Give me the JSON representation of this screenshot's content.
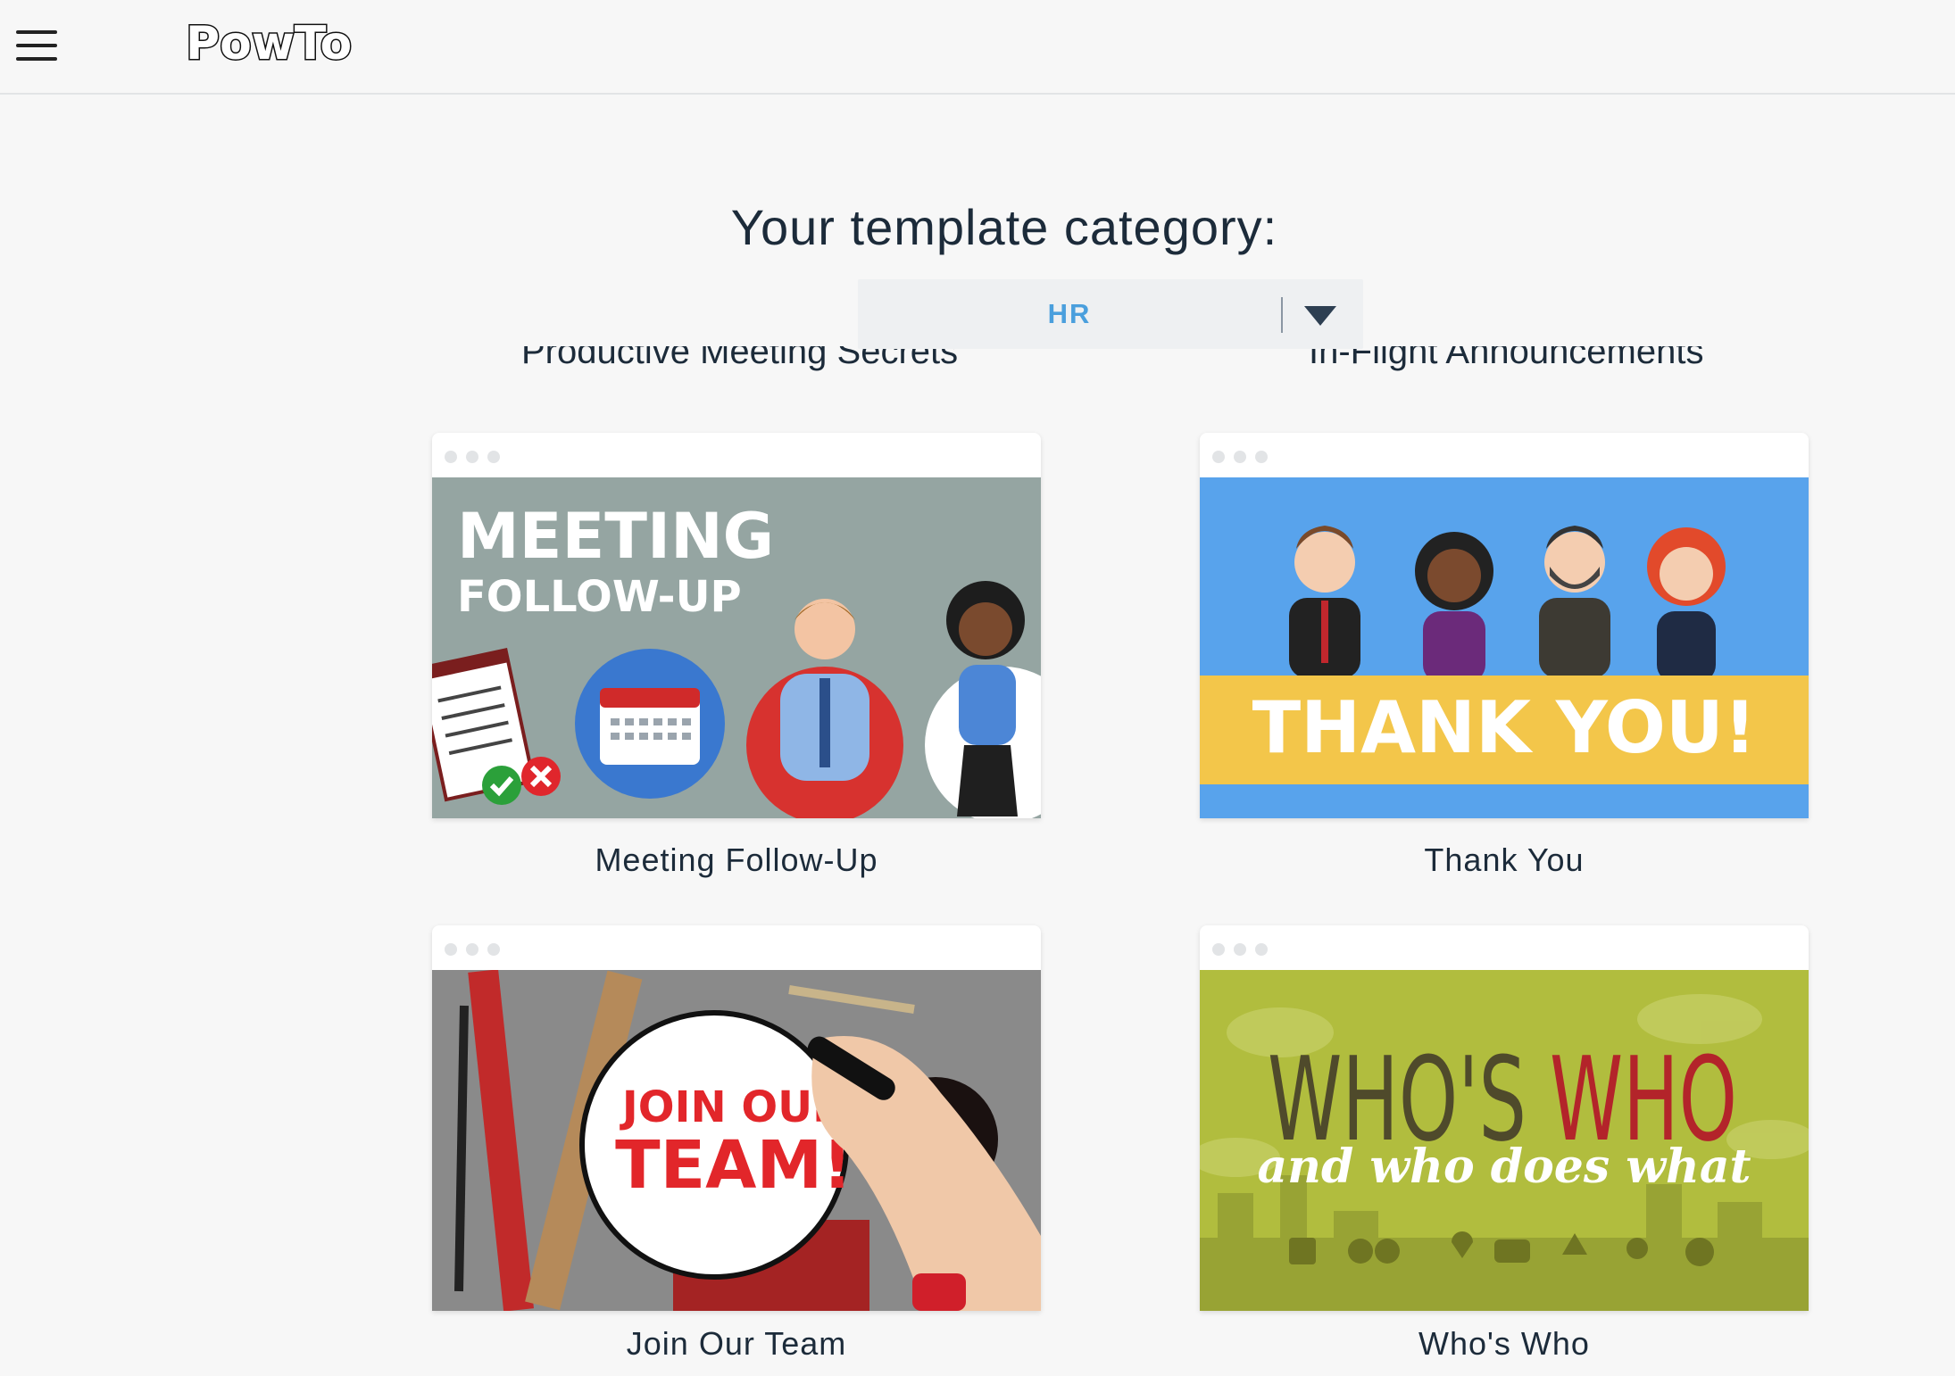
{
  "header": {
    "menu_icon": "hamburger-menu-icon",
    "logo_text": "PowToon"
  },
  "page": {
    "heading": "Your template category:",
    "category_select": {
      "value": "HR",
      "icon": "caret-down-icon"
    },
    "partially_hidden_captions": [
      "Productive Meeting Secrets",
      "In-Flight Announcements"
    ]
  },
  "templates": [
    {
      "title": "Meeting Follow-Up",
      "thumb_line1": "MEETING",
      "thumb_line2": "FOLLOW-UP"
    },
    {
      "title": "Thank You",
      "thumb_text": "THANK YOU!"
    },
    {
      "title": "Join Our Team",
      "thumb_line1": "JOIN OUR",
      "thumb_line2": "TEAM!"
    },
    {
      "title": "Who's Who",
      "thumb_line1a": "WHO'S",
      "thumb_line1b": "WHO",
      "thumb_line2": "and who does what"
    }
  ],
  "colors": {
    "accent": "#4a9fdd",
    "text": "#1c2b3a",
    "meeting_bg": "#95a5a2",
    "thankyou_bg": "#58a3ec",
    "thankyou_band": "#f3c64a",
    "whoswho_bg": "#b1bd3e",
    "join_red": "#e2262a"
  }
}
